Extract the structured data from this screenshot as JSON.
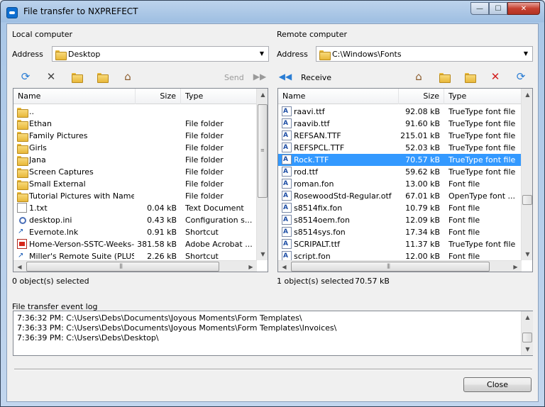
{
  "window": {
    "title": "File transfer to NXPREFECT"
  },
  "local": {
    "section_label": "Local computer",
    "address_label": "Address",
    "address_value": "Desktop",
    "send_label": "Send",
    "columns": {
      "name": "Name",
      "size": "Size",
      "type": "Type"
    },
    "rows": [
      {
        "name": "..",
        "size": "",
        "type": "",
        "icon": "up-folder"
      },
      {
        "name": "Ethan",
        "size": "",
        "type": "File folder",
        "icon": "folder"
      },
      {
        "name": "Family Pictures",
        "size": "",
        "type": "File folder",
        "icon": "folder"
      },
      {
        "name": "Girls",
        "size": "",
        "type": "File folder",
        "icon": "folder"
      },
      {
        "name": "Jana",
        "size": "",
        "type": "File folder",
        "icon": "folder"
      },
      {
        "name": "Screen Captures",
        "size": "",
        "type": "File folder",
        "icon": "folder"
      },
      {
        "name": "Small External",
        "size": "",
        "type": "File folder",
        "icon": "folder"
      },
      {
        "name": "Tutorial Pictures with Names",
        "size": "",
        "type": "File folder",
        "icon": "folder"
      },
      {
        "name": "1.txt",
        "size": "0.04 kB",
        "type": "Text Document",
        "icon": "file"
      },
      {
        "name": "desktop.ini",
        "size": "0.43 kB",
        "type": "Configuration s...",
        "icon": "ini"
      },
      {
        "name": "Evernote.lnk",
        "size": "0.91 kB",
        "type": "Shortcut",
        "icon": "lnk"
      },
      {
        "name": "Home-Verson-SSTC-Weeks-...",
        "size": "381.58 kB",
        "type": "Adobe Acrobat ...",
        "icon": "pdf"
      },
      {
        "name": "Miller's Remote Suite (PLUS)...",
        "size": "2.26 kB",
        "type": "Shortcut",
        "icon": "lnk"
      }
    ],
    "status": "0 object(s) selected"
  },
  "remote": {
    "section_label": "Remote computer",
    "address_label": "Address",
    "address_value": "C:\\Windows\\Fonts",
    "receive_label": "Receive",
    "columns": {
      "name": "Name",
      "size": "Size",
      "type": "Type"
    },
    "rows": [
      {
        "name": "raavi.ttf",
        "size": "92.08 kB",
        "type": "TrueType font file",
        "selected": false
      },
      {
        "name": "raavib.ttf",
        "size": "91.60 kB",
        "type": "TrueType font file",
        "selected": false
      },
      {
        "name": "REFSAN.TTF",
        "size": "215.01 kB",
        "type": "TrueType font file",
        "selected": false
      },
      {
        "name": "REFSPCL.TTF",
        "size": "52.03 kB",
        "type": "TrueType font file",
        "selected": false
      },
      {
        "name": "Rock.TTF",
        "size": "70.57 kB",
        "type": "TrueType font file",
        "selected": true
      },
      {
        "name": "rod.ttf",
        "size": "59.62 kB",
        "type": "TrueType font file",
        "selected": false
      },
      {
        "name": "roman.fon",
        "size": "13.00 kB",
        "type": "Font file",
        "selected": false
      },
      {
        "name": "RosewoodStd-Regular.otf",
        "size": "67.01 kB",
        "type": "OpenType font ...",
        "selected": false
      },
      {
        "name": "s8514fix.fon",
        "size": "10.79 kB",
        "type": "Font file",
        "selected": false
      },
      {
        "name": "s8514oem.fon",
        "size": "12.09 kB",
        "type": "Font file",
        "selected": false
      },
      {
        "name": "s8514sys.fon",
        "size": "17.34 kB",
        "type": "Font file",
        "selected": false
      },
      {
        "name": "SCRIPALT.ttf",
        "size": "11.37 kB",
        "type": "TrueType font file",
        "selected": false
      },
      {
        "name": "script.fon",
        "size": "12.00 kB",
        "type": "Font file",
        "selected": false
      }
    ],
    "status": "1 object(s) selected",
    "status_size": "70.57 kB"
  },
  "log": {
    "label": "File transfer event log",
    "lines": [
      "7:36:32 PM: C:\\Users\\Debs\\Documents\\Joyous Moments\\Form Templates\\",
      "7:36:33 PM: C:\\Users\\Debs\\Documents\\Joyous Moments\\Form Templates\\Invoices\\",
      "7:36:39 PM: C:\\Users\\Debs\\Desktop\\"
    ]
  },
  "close_label": "Close",
  "icons": {
    "refresh": "refresh-icon",
    "delete": "delete-icon",
    "new_folder": "new-folder-icon",
    "up_folder": "up-folder-icon",
    "home": "home-icon",
    "send": "send-icon",
    "receive": "receive-icon"
  },
  "colors": {
    "selection": "#3399ff",
    "delete_red": "#d21e1e",
    "refresh_blue": "#2a7dd4"
  }
}
